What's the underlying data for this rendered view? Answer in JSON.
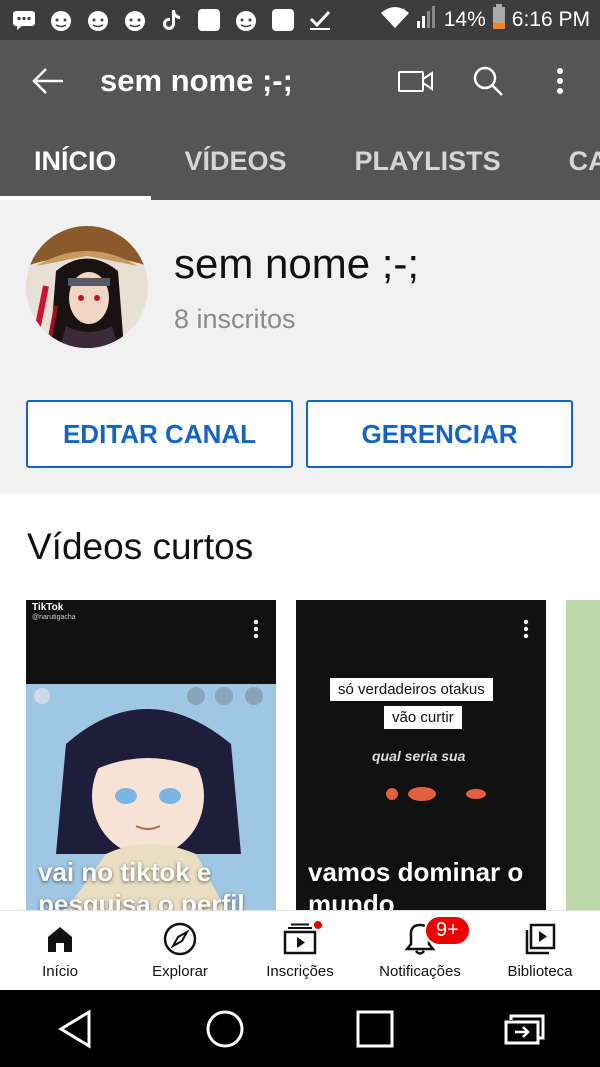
{
  "status_bar": {
    "battery": "14%",
    "time": "6:16 PM",
    "notification_icons": [
      "message-icon",
      "android-face-icon",
      "android-face-icon",
      "android-face-icon",
      "tiktok-icon",
      "square-icon",
      "android-face-icon",
      "square-icon",
      "check-icon"
    ]
  },
  "app_bar": {
    "title": "sem nome ;-;"
  },
  "tabs": [
    {
      "label": "INÍCIO",
      "active": true
    },
    {
      "label": "VÍDEOS",
      "active": false
    },
    {
      "label": "PLAYLISTS",
      "active": false
    },
    {
      "label": "CANAIS",
      "active": false
    }
  ],
  "channel": {
    "name": "sem nome ;-;",
    "subscribers": "8 inscritos",
    "edit_label": "EDITAR CANAL",
    "manage_label": "GERENCIAR"
  },
  "shorts": {
    "section_title": "Vídeos curtos",
    "cards": [
      {
        "caption": "vai no tiktok e pesquisa o perfil",
        "tiktok_logo": "TikTok",
        "tiktok_user": "@narutigacha"
      },
      {
        "caption": "vamos dominar o mundo",
        "overlay_line1": "só verdadeiros otakus",
        "overlay_line2": "vão curtir",
        "overlay_line3": "qual seria sua"
      }
    ]
  },
  "bottom_nav": {
    "items": [
      {
        "label": "Início"
      },
      {
        "label": "Explorar"
      },
      {
        "label": "Inscrições"
      },
      {
        "label": "Notificações",
        "badge": "9+"
      },
      {
        "label": "Biblioteca"
      }
    ]
  },
  "colors": {
    "app_bar": "#555555",
    "accent_blue": "#1565c0",
    "badge_red": "#ee0000"
  }
}
